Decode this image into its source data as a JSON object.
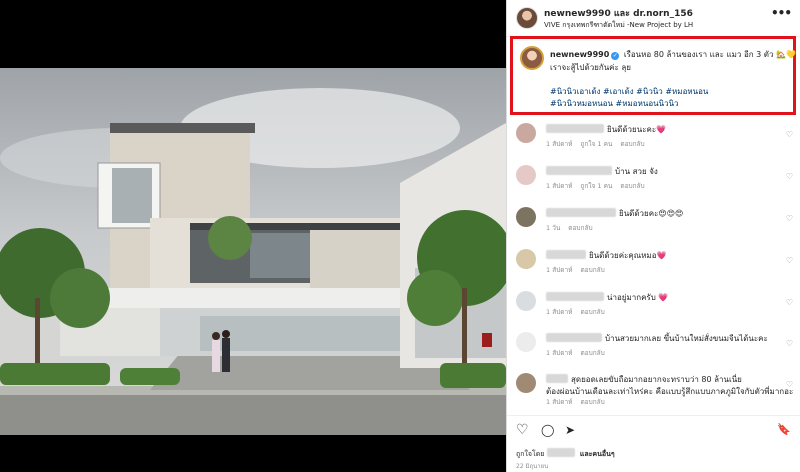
{
  "post": {
    "header": {
      "username": "newnew9990 และ dr.norn_156",
      "location": "VIVE กรุงเทพกรีฑาตัดใหม่ -New Project by LH",
      "more_label": "•••"
    },
    "caption": {
      "username": "newnew9990",
      "verified_mark": "✓",
      "text_line1": "เรือนหอ 80 ล้านของเรา และ แมว อีก 3 ตัว 🏡💛",
      "text_line2": "เราจะสู้ไปด้วยกันค่ะ ลุย",
      "hashtags_line1": "#นิวนิวเอาเด้ง #เอาเด้ง #นิวนิว #หมอหนอน",
      "hashtags_line2": "#นิวนิวหมอหนอน #หมอหนอนนิวนิว"
    },
    "comments": [
      {
        "text": "ยินดีด้วยนะคะ💗",
        "time": "1 สัปดาห์",
        "likes": "ถูกใจ 1 คน",
        "reply": "ตอบกลับ",
        "avatar_color": "#c9a8a0",
        "blur_width": 58
      },
      {
        "text": "บ้าน สวย จัง",
        "time": "1 สัปดาห์",
        "likes": "ถูกใจ 1 คน",
        "reply": "ตอบกลับ",
        "avatar_color": "#e5c9c6",
        "blur_width": 66
      },
      {
        "text": "ยินดีด้วยคะ😍😍😍",
        "time": "1 วัน",
        "likes": "",
        "reply": "ตอบกลับ",
        "avatar_color": "#7d7361",
        "blur_width": 70
      },
      {
        "text": "ยินดีด้วยค่ะคุณหมอ💗",
        "time": "1 สัปดาห์",
        "likes": "",
        "reply": "ตอบกลับ",
        "avatar_color": "#d9c8a8",
        "blur_width": 40
      },
      {
        "text": "น่าอยู่มากครับ 💗",
        "time": "1 สัปดาห์",
        "likes": "",
        "reply": "ตอบกลับ",
        "avatar_color": "#dadde0",
        "blur_width": 58
      },
      {
        "text": "บ้านสวยมากเลย ขึ้นบ้านใหม่สั่งขนมจีนได้นะคะ",
        "time": "1 สัปดาห์",
        "likes": "",
        "reply": "ตอบกลับ",
        "avatar_color": "#ececec",
        "blur_width": 56
      },
      {
        "text": "สุดยอดเลยขับถือมากอยากจะทราบว่า 80 ล้านเนี่ย",
        "text2": "ต้องผ่อนบ้านเดือนละเท่าไหร่คะ คือแบบรู้สึกแบบภาคภูมิใจกับตัวพี่มากอะ",
        "time": "1 สัปดาห์",
        "likes": "",
        "reply": "ตอบกลับ",
        "avatar_color": "#a08a74",
        "blur_width": 22
      }
    ],
    "heart_icon": "♡",
    "actions": {
      "like_icon": "♡",
      "comment_icon": "◯",
      "share_icon": "➤",
      "save_icon": "🔖",
      "liked_by_prefix": "ถูกใจโดย",
      "liked_by_suffix": "และคนอื่นๆ",
      "date": "22 มิถุนายน"
    }
  },
  "colors": {
    "highlight_border": "#e0121a",
    "hashtag": "#00376b",
    "meta_gray": "#8e8e8e"
  }
}
